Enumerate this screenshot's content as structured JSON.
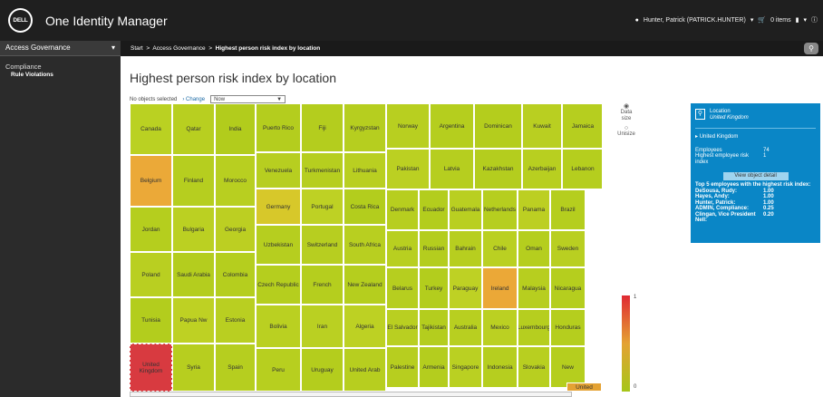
{
  "app": {
    "brand": "DELL",
    "title": "One Identity Manager"
  },
  "user": {
    "name": "Hunter, Patrick (PATRICK.HUNTER)",
    "cart": "0 items"
  },
  "sidebar": {
    "section": "Access Governance",
    "group": "Compliance",
    "item": "Rule Violations"
  },
  "breadcrumb": {
    "start": "Start",
    "parent": "Access Governance",
    "current": "Highest person risk index by location"
  },
  "page": {
    "title": "Highest person risk index by location",
    "selection_text": "No objects selected",
    "change_label": "Change",
    "dropdown_value": "Now"
  },
  "treemap": {
    "columns": [
      {
        "cells": [
          {
            "label": "Canada",
            "color": "#bad122"
          },
          {
            "label": "Belgium",
            "color": "#eba938"
          },
          {
            "label": "Jordan",
            "color": "#b5ce1e"
          },
          {
            "label": "Poland",
            "color": "#b9cf21"
          },
          {
            "label": "Tunisia",
            "color": "#b3cd1d"
          },
          {
            "label": "United Kingdom",
            "color": "#d83a40",
            "selected": true
          }
        ]
      },
      {
        "cells": [
          {
            "label": "Qatar",
            "color": "#b8cf20"
          },
          {
            "label": "Finland",
            "color": "#b6ce1f"
          },
          {
            "label": "Bulgaria",
            "color": "#bbd022"
          },
          {
            "label": "Saudi Arabia",
            "color": "#b4cd1e"
          },
          {
            "label": "Papua Nw",
            "color": "#bed123"
          },
          {
            "label": "Syria",
            "color": "#b7ce1f"
          }
        ]
      },
      {
        "cells": [
          {
            "label": "India",
            "color": "#b2cc1c"
          },
          {
            "label": "Morocco",
            "color": "#b8cf20"
          },
          {
            "label": "Georgia",
            "color": "#bccf22"
          },
          {
            "label": "Colombia",
            "color": "#b5ce1e"
          },
          {
            "label": "Estonia",
            "color": "#b9cf21"
          },
          {
            "label": "Spain",
            "color": "#b6ce1f"
          }
        ]
      },
      {
        "cells": [
          {
            "label": "Puerto Rico",
            "color": "#b4cd1e"
          },
          {
            "label": "Venezuela",
            "color": "#b7ce20"
          },
          {
            "label": "Germany",
            "color": "#d7c82a"
          },
          {
            "label": "Uzbekistan",
            "color": "#b6ce1f"
          },
          {
            "label": "Czech Republic",
            "color": "#b5ce1e"
          },
          {
            "label": "Bolivia",
            "color": "#bad021"
          },
          {
            "label": "Peru",
            "color": "#b7cf1f"
          }
        ]
      },
      {
        "cells": [
          {
            "label": "Fiji",
            "color": "#b4cd1e"
          },
          {
            "label": "Turkmenistan",
            "color": "#b6ce1f"
          },
          {
            "label": "Portugal",
            "color": "#bed124"
          },
          {
            "label": "Switzerland",
            "color": "#b7ce20"
          },
          {
            "label": "French",
            "color": "#b5ce1e"
          },
          {
            "label": "Iran",
            "color": "#bad022"
          },
          {
            "label": "Uruguay",
            "color": "#b4cd1d"
          }
        ]
      },
      {
        "cells": [
          {
            "label": "Kyrgyzstan",
            "color": "#b6ce1f"
          },
          {
            "label": "Lithuania",
            "color": "#b9cf21"
          },
          {
            "label": "Costa Rica",
            "color": "#b3cd1d"
          },
          {
            "label": "South Africa",
            "color": "#b8cf20"
          },
          {
            "label": "New Zealand",
            "color": "#b5ce1e"
          },
          {
            "label": "Algeria",
            "color": "#bdd123"
          },
          {
            "label": "United Arab",
            "color": "#b7ce1f"
          }
        ]
      }
    ],
    "rows": [
      {
        "cells": [
          {
            "label": "Norway",
            "color": "#b8cf20"
          },
          {
            "label": "Argentina",
            "color": "#b5ce1e"
          },
          {
            "label": "Dominican",
            "color": "#b4cd1d"
          },
          {
            "label": "Kuwait",
            "color": "#b9cf21"
          },
          {
            "label": "Jamaica",
            "color": "#b6ce1f"
          }
        ]
      },
      {
        "cells": [
          {
            "label": "Pakistan",
            "color": "#bbd022"
          },
          {
            "label": "Latvia",
            "color": "#b6ce1f"
          },
          {
            "label": "Kazakhstan",
            "color": "#b4cd1e"
          },
          {
            "label": "Azerbaijan",
            "color": "#b8cf20"
          },
          {
            "label": "Lebanon",
            "color": "#b5ce1e"
          }
        ]
      },
      {
        "cells": [
          {
            "label": "Denmark",
            "color": "#b7ce1f"
          },
          {
            "label": "Ecuador",
            "color": "#b3cd1d"
          },
          {
            "label": "Guatemala",
            "color": "#b9cf21"
          },
          {
            "label": "Netherlands",
            "color": "#b6ce1f"
          },
          {
            "label": "Panama",
            "color": "#bccf22"
          },
          {
            "label": "Brazil",
            "color": "#b5ce1e"
          }
        ]
      },
      {
        "cells": [
          {
            "label": "Austria",
            "color": "#b8cf20"
          },
          {
            "label": "Russian",
            "color": "#b4cd1e"
          },
          {
            "label": "Bahrain",
            "color": "#b7ce1f"
          },
          {
            "label": "Chile",
            "color": "#bad022"
          },
          {
            "label": "Oman",
            "color": "#b5ce1e"
          },
          {
            "label": "Sweden",
            "color": "#b9cf21"
          }
        ]
      },
      {
        "cells": [
          {
            "label": "Belarus",
            "color": "#b6ce1f"
          },
          {
            "label": "Turkey",
            "color": "#b3cd1d"
          },
          {
            "label": "Paraguay",
            "color": "#bed124"
          },
          {
            "label": "Ireland",
            "color": "#eba837"
          },
          {
            "label": "Malaysia",
            "color": "#b7ce1f"
          },
          {
            "label": "Nicaragua",
            "color": "#b5ce1e"
          }
        ]
      },
      {
        "cells": [
          {
            "label": "El Salvador",
            "color": "#b9cf21"
          },
          {
            "label": "Tajikistan",
            "color": "#b4cd1e"
          },
          {
            "label": "Australia",
            "color": "#b8cf20"
          },
          {
            "label": "Mexico",
            "color": "#bbd022"
          },
          {
            "label": "Luxembourg",
            "color": "#b6ce1f"
          },
          {
            "label": "Honduras",
            "color": "#b5ce1e"
          }
        ]
      },
      {
        "cells": [
          {
            "label": "Palestine",
            "color": "#b7ce1f"
          },
          {
            "label": "Armenia",
            "color": "#b4cd1e"
          },
          {
            "label": "Singapore",
            "color": "#bad022"
          },
          {
            "label": "Indonesia",
            "color": "#b6ce1f"
          },
          {
            "label": "Slovakia",
            "color": "#b8cf20"
          },
          {
            "label": "New",
            "color": "#b5ce1e"
          }
        ]
      }
    ],
    "overflow_label": "United"
  },
  "options": {
    "data_size": "Data size",
    "unisize": "Unisize"
  },
  "legend": {
    "max": "1",
    "min": "0"
  },
  "info": {
    "title": "Location",
    "subtitle": "United Kingdom",
    "section": "United Kingdom",
    "employees_label": "Employees",
    "employees_value": "74",
    "risk_label": "Highest employee risk index",
    "risk_value": "1",
    "button": "View object detail",
    "top5_title": "Top 5 employees with the highest risk index:",
    "top5": [
      {
        "name": "DeSousa, Rudy:",
        "value": "1.00"
      },
      {
        "name": "Hayes, Andy:",
        "value": "1.00"
      },
      {
        "name": "Hunter, Patrick:",
        "value": "1.00"
      },
      {
        "name": "ADMIN, Compliance:",
        "value": "0.25"
      },
      {
        "name": "Clingan, Vice President",
        "value": "0.20"
      },
      {
        "name": "Nell:",
        "value": ""
      }
    ]
  }
}
